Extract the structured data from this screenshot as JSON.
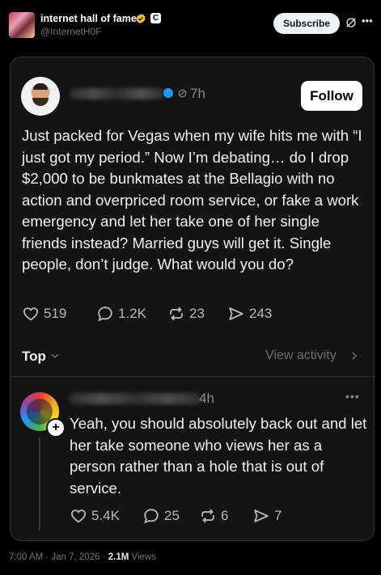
{
  "account": {
    "name": "internet hall of fame",
    "handle": "@InternetH0F",
    "affiliate_badge": "C",
    "subscribe_label": "Subscribe"
  },
  "post": {
    "time": "7h",
    "follow_label": "Follow",
    "text": "Just packed for Vegas when my wife hits me with “I just got my period.” Now I’m debating… do I drop $2,000 to be bunkmates at the Bellagio with no action and overpriced room service, or fake a work emergency and let her take one of her single friends instead? Married guys will get it. Single people, don’t judge. What would you do?",
    "likes": "519",
    "replies": "1.2K",
    "reposts": "23",
    "shares": "243"
  },
  "sort": {
    "label": "Top",
    "view_activity": "View activity"
  },
  "reply": {
    "time": "4h",
    "more": "•••",
    "text": "Yeah, you should absolutely back out and let her take someone who views her as a person rather than a hole that is out of service.",
    "likes": "5.4K",
    "replies": "25",
    "reposts": "6",
    "shares": "7"
  },
  "footer": {
    "timestamp": "7:00 AM · Jan 7, 2026 · ",
    "views_count": "2.1M",
    "views_label": " Views"
  },
  "icons": {
    "header": [
      "verified-icon",
      "grok-icon",
      "more-icon"
    ],
    "stats": [
      "heart-icon",
      "reply-icon",
      "repost-icon",
      "share-icon"
    ]
  },
  "colors": {
    "verified": "#f4c430",
    "blue_dot": "#1d9bf0",
    "background": "#000000",
    "card": "#141414"
  }
}
